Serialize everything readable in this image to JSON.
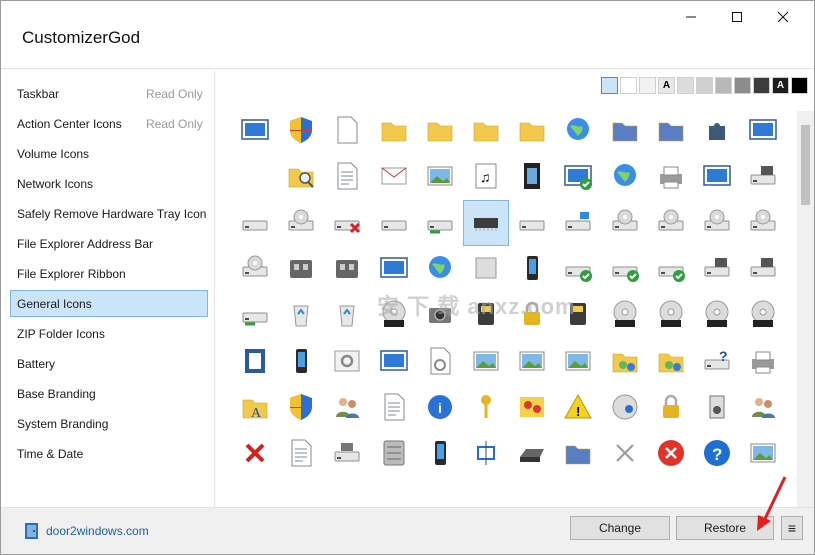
{
  "window": {
    "title": "CustomizerGod"
  },
  "title_buttons": {
    "minimize_glyph": "—",
    "maximize_glyph": "☐",
    "close_glyph": "✕"
  },
  "sidebar": {
    "items": [
      {
        "label": "Taskbar",
        "status": "Read Only"
      },
      {
        "label": "Action Center Icons",
        "status": "Read Only"
      },
      {
        "label": "Volume Icons",
        "status": ""
      },
      {
        "label": "Network Icons",
        "status": ""
      },
      {
        "label": "Safely Remove Hardware Tray Icon",
        "status": ""
      },
      {
        "label": "File Explorer Address Bar",
        "status": ""
      },
      {
        "label": "File Explorer Ribbon",
        "status": ""
      },
      {
        "label": "General Icons",
        "status": "",
        "selected": true
      },
      {
        "label": "ZIP Folder Icons",
        "status": ""
      },
      {
        "label": "Battery",
        "status": ""
      },
      {
        "label": "Base Branding",
        "status": ""
      },
      {
        "label": "System Branding",
        "status": ""
      },
      {
        "label": "Time & Date",
        "status": ""
      }
    ]
  },
  "background_swatches": [
    "#cce4f7",
    "#ffffff",
    "#f2f2f2",
    "#e8e8e8",
    "#dcdcdc",
    "#cfcfcf",
    "#b8b8b8",
    "#8c8c8c",
    "#3c3c3c",
    "#1e1e1e",
    "#000000"
  ],
  "swatch_letter": "A",
  "icons": [
    [
      "taskbar-screen-icon",
      "security-shield-icon",
      "blank-document-icon",
      "folder-icon",
      "folder-icon",
      "folder-icon",
      "folder-thin-icon",
      "globe-sphere-icon",
      "folder-blue-icon",
      "folder-blue-thin-icon",
      "puzzle-piece-icon",
      "window-app-icon"
    ],
    [
      "empty-cell",
      "folder-search-icon",
      "text-document-icon",
      "envelope-icon",
      "image-frame-icon",
      "music-sheet-icon",
      "film-strip-icon",
      "verified-screen-icon",
      "network-globe-icon",
      "printer-icon",
      "presentation-icon",
      "floppy-drive-icon"
    ],
    [
      "drive-icon",
      "optical-drive-icon",
      "drive-removed-icon",
      "drive-icon",
      "network-drive-icon",
      "chip-drive-icon",
      "slim-drive-icon",
      "windows-drive-icon",
      "dvd-drive-icon",
      "dvd-r-drive-icon",
      "dvd-ram-drive-icon",
      "dvd-rom-drive-icon"
    ],
    [
      "dvd-rw-drive-icon",
      "usb-drive-icon",
      "usb-drive-icon",
      "media-center-icon",
      "network-shortcut-icon",
      "media-collection-icon",
      "phone-icon",
      "drive-check-icon",
      "drive-check-icon",
      "drive-check-icon",
      "floppy-drive-icon",
      "floppy-drive-icon"
    ],
    [
      "drive-network-icon",
      "recycle-bin-icon",
      "recycle-bin-full-icon",
      "dvd-disc-icon",
      "camera-icon",
      "card-reader-icon",
      "lock-icon",
      "sd-card-icon",
      "cd-disc-icon",
      "cd-r-disc-icon",
      "cd-rom-disc-icon",
      "cd-rw-disc-icon"
    ],
    [
      "contacts-book-icon",
      "mp3-player-icon",
      "settings-gears-icon",
      "settings-window-icon",
      "gear-document-icon",
      "image-gallery-icon",
      "picture-frame-icon",
      "landscape-image-icon",
      "shared-folder-icon",
      "shared-folder-icon",
      "help-drive-icon",
      "printer-icon"
    ],
    [
      "font-folder-icon",
      "uac-shield-icon",
      "users-icon",
      "checklist-icon",
      "info-circle-icon",
      "key-icon",
      "photo-flowers-icon",
      "warning-icon",
      "music-disc-icon",
      "clock-sync-icon",
      "speaker-box-icon",
      "users-icon"
    ],
    [
      "error-x-icon",
      "document-lines-icon",
      "drive-stack-icon",
      "server-icon",
      "mobile-device-icon",
      "crop-frame-icon",
      "scanner-icon",
      "blue-folder-icon",
      "small-x-icon",
      "error-circle-icon",
      "help-circle-icon",
      "picture-stack-icon"
    ]
  ],
  "selected_icon": {
    "row": 2,
    "col": 5
  },
  "footer": {
    "brand_text": "door2windows.com",
    "change_label": "Change",
    "restore_label": "Restore",
    "menu_glyph": "≡"
  },
  "watermark": "安 下 载 anxz.com"
}
